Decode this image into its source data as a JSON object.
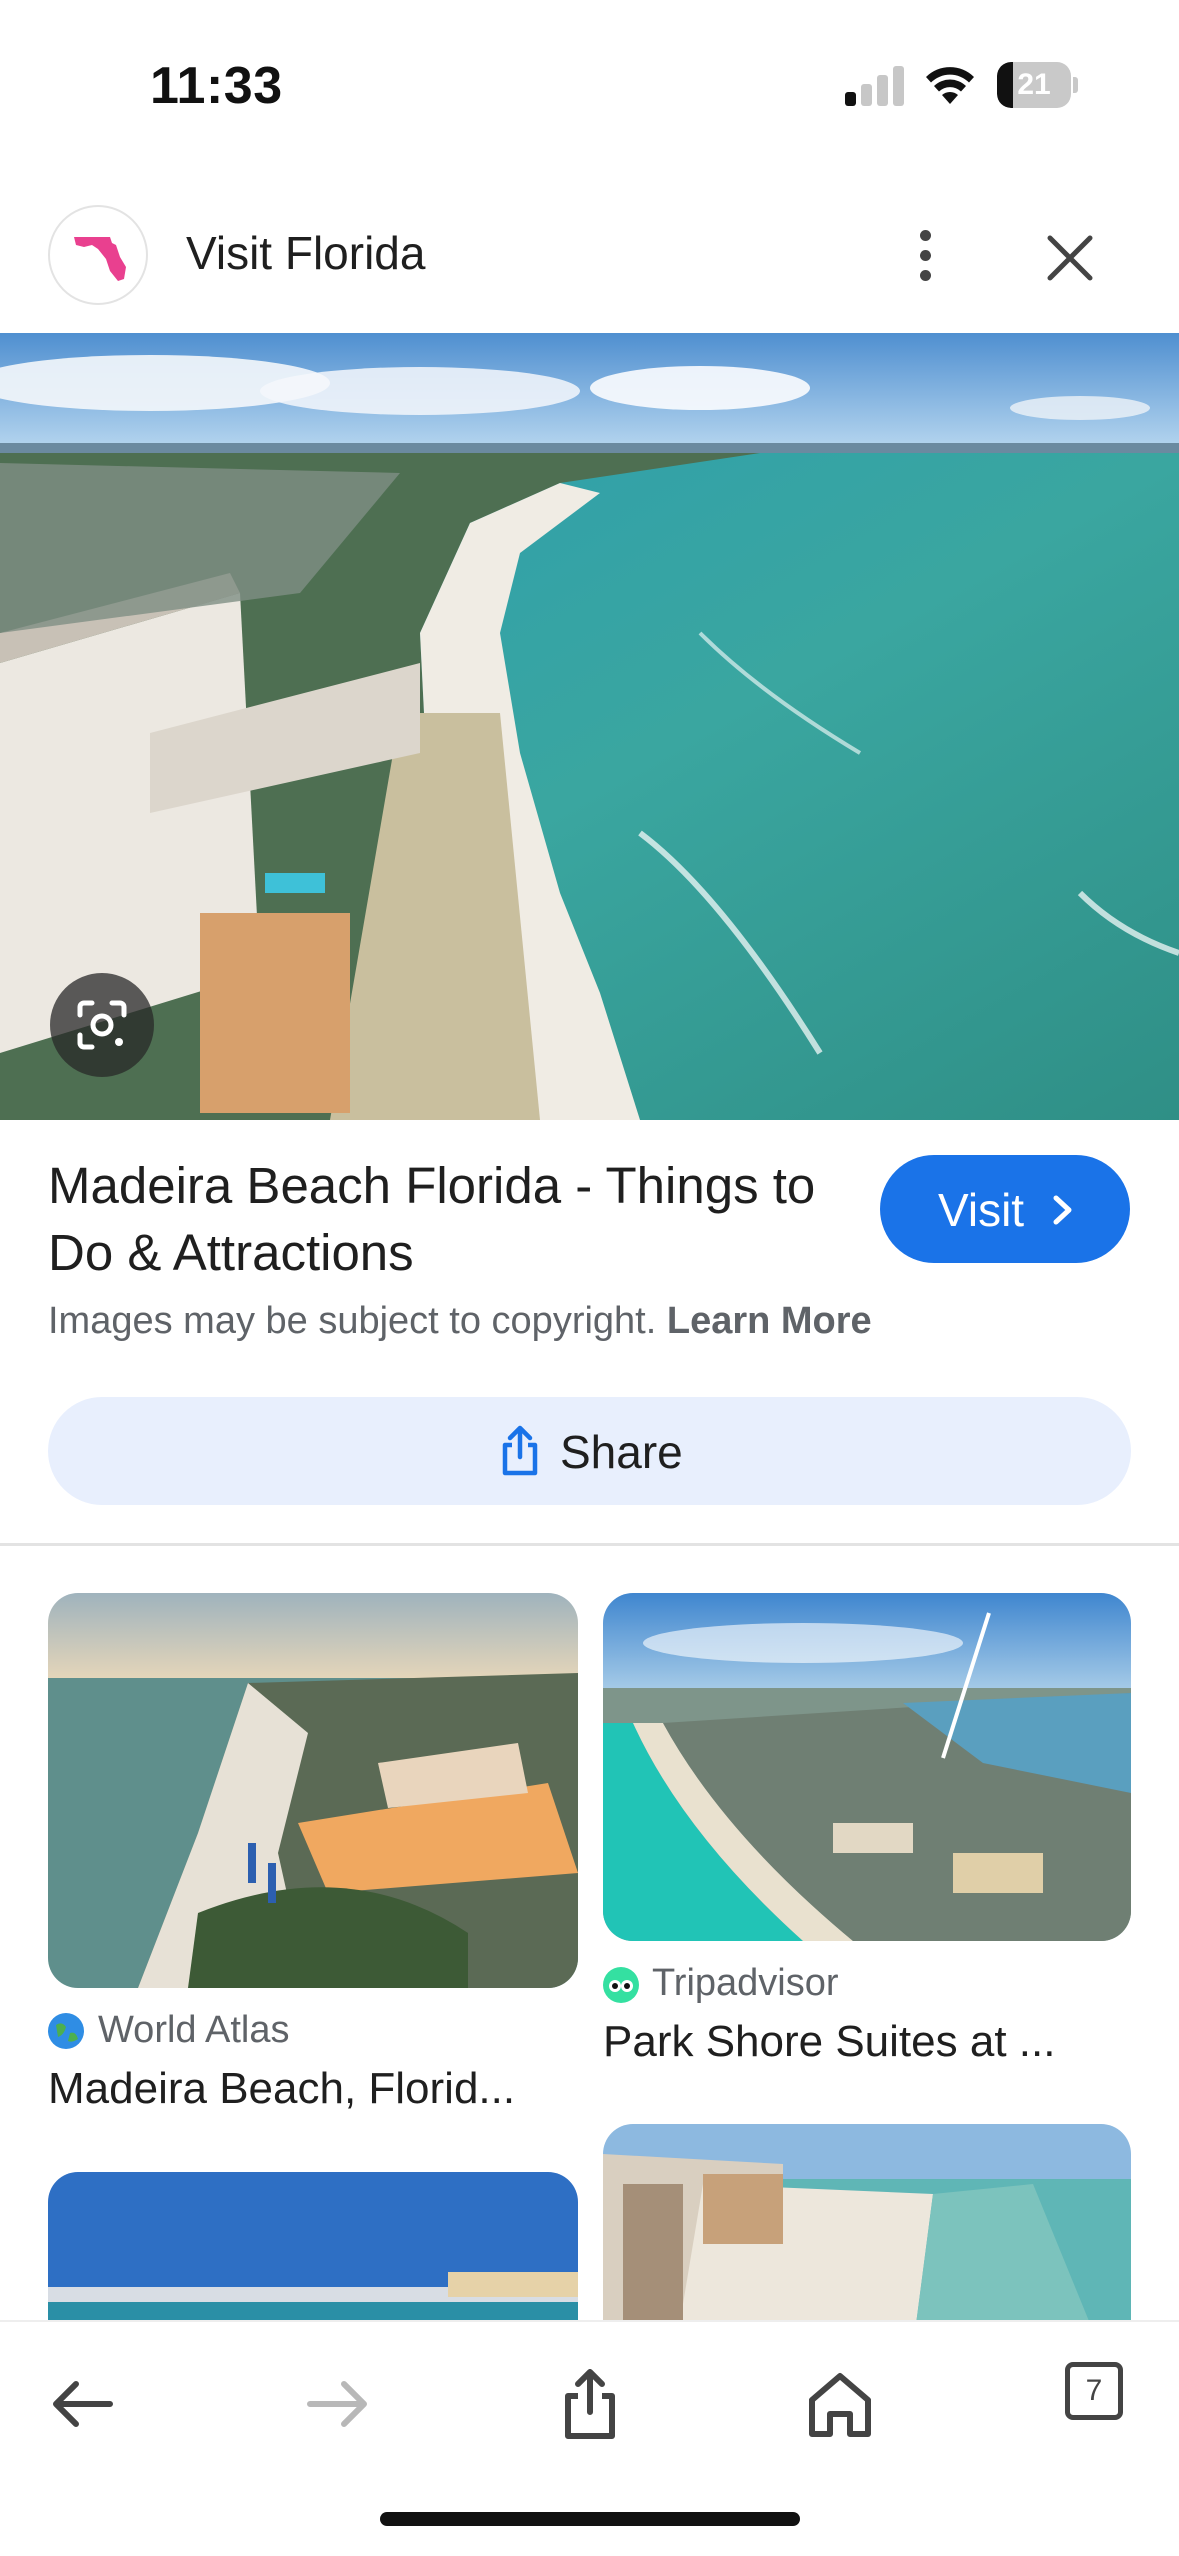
{
  "status_bar": {
    "time": "11:33",
    "battery_level": "21",
    "battery_fraction": 0.21,
    "signal_bars_active": 1,
    "icons": [
      "cellular-signal-icon",
      "wifi-icon",
      "battery-icon"
    ]
  },
  "header": {
    "site_name": "Visit Florida",
    "favicon": "florida-state-icon",
    "more_icon": "more-vert-icon",
    "close_icon": "close-icon"
  },
  "result": {
    "title": "Madeira Beach Florida - Things to Do & Attractions",
    "visit_label": "Visit",
    "copyright_text": "Images may be subject to copyright.",
    "learn_more": "Learn More",
    "share_label": "Share",
    "lens_icon": "google-lens-icon"
  },
  "related": [
    {
      "source": "World Atlas",
      "title": "Madeira Beach, Florid...",
      "source_icon": "globe-icon"
    },
    {
      "source": "Tripadvisor",
      "title": "Park Shore Suites at ...",
      "source_icon": "tripadvisor-owl-icon"
    }
  ],
  "toolbar": {
    "tabs_count": "7",
    "icons": [
      "back-arrow-icon",
      "forward-arrow-icon",
      "share-icon",
      "home-icon",
      "tabs-icon"
    ]
  },
  "colors": {
    "accent": "#1a73e8",
    "share_bg": "#e8effd",
    "secondary_text": "#5f6368"
  }
}
